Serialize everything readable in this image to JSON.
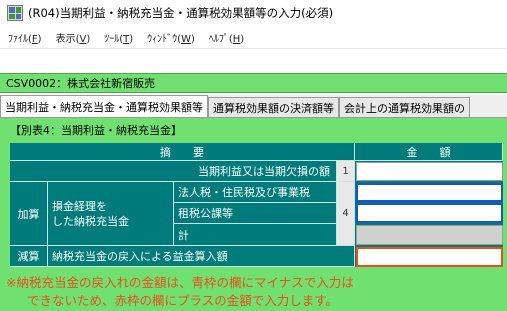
{
  "window": {
    "title": "(R04)当期利益・納税充当金・通算税効果額等の入力(必須)"
  },
  "menu": [
    {
      "label": "ﾌｧｲﾙ(",
      "key": "F",
      "close": ")"
    },
    {
      "label": "表示(",
      "key": "V",
      "close": ")"
    },
    {
      "label": "ﾂｰﾙ(",
      "key": "T",
      "close": ")"
    },
    {
      "label": "ｳｨﾝﾄﾞｳ(",
      "key": "W",
      "close": ")"
    },
    {
      "label": "ﾍﾙﾌﾟ(",
      "key": "H",
      "close": ")"
    }
  ],
  "company": "CSV0002：株式会社新宿販売",
  "tabs": [
    "当期利益・納税充当金・通算税効果額等",
    "通算税効果額の決済額等",
    "会計上の通算税効果額の"
  ],
  "section_title": "【別表4：当期利益・納税充当金】",
  "table": {
    "header_summary": "摘　　要",
    "header_amount": "金　　額",
    "row1_label": "当期利益又は当期欠損の額",
    "row1_no": "1",
    "add_label": "加算",
    "add_group_label": "損金経理を\nした納税充当金",
    "add_item1": "法人税・住民税及び事業税",
    "add_item2": "租税公課等",
    "add_item3": "計",
    "add_no": "4",
    "sub_label": "減算",
    "sub_item": "納税充当金の戻入による益金算入額"
  },
  "note": {
    "line1": "※納税充当金の戻入れの金額は、青枠の欄にマイナスで入力は",
    "line2": "できないため、赤枠の欄にプラスの金額で入力します。"
  },
  "colors": {
    "accent_green": "#70e070",
    "table_teal": "#007b7b",
    "blue_frame": "#1a55c8",
    "red_frame": "#e8501e"
  }
}
